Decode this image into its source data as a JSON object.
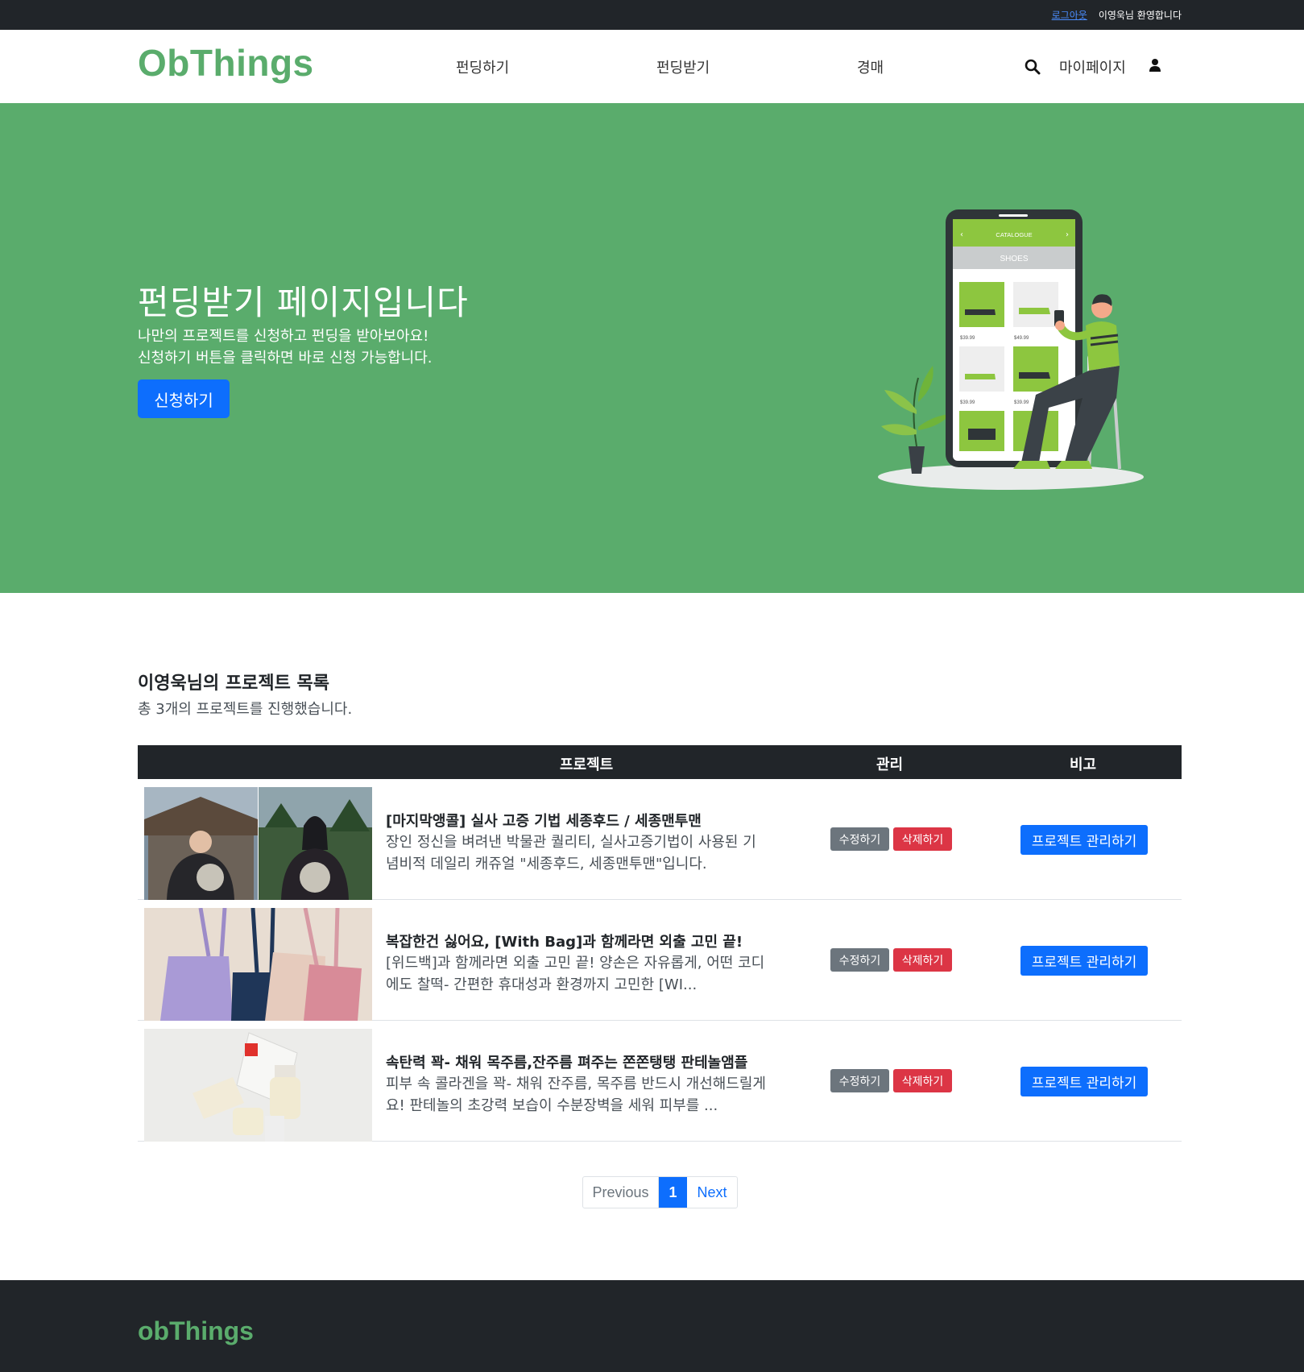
{
  "topbar": {
    "logout": "로그아웃",
    "welcome": "이영욱님 환영합니다"
  },
  "nav": {
    "logo": "ObThings",
    "items": [
      "펀딩하기",
      "펀딩받기",
      "경매"
    ],
    "mypage": "마이페이지",
    "icons": [
      "search-icon",
      "user-icon"
    ]
  },
  "hero": {
    "title": "펀딩받기 페이지입니다",
    "line1": "나만의 프로젝트를 신청하고 펀딩을 받아보아요!",
    "line2": "신청하기 버튼을 클릭하면 바로 신청 가능합니다.",
    "apply_label": "신청하기",
    "phone": {
      "header": "CATALOGUE",
      "category": "SHOES",
      "prices": [
        "$39.99",
        "$49.99",
        "$39.99",
        "$39.99"
      ]
    }
  },
  "list": {
    "title": "이영욱님의 프로젝트 목록",
    "summary": "총 3개의 프로젝트를 진행했습니다.",
    "headers": {
      "project": "프로젝트",
      "manage": "관리",
      "note": "비고"
    },
    "rows": [
      {
        "title": "[마지막앵콜] 실사 고증 기법 세종후드 / 세종맨투맨",
        "desc1": "장인 정신을 벼려낸 박물관 퀄리티, 실사고증기법이 사용된 기",
        "desc2": "념비적 데일리 캐쥬얼 \"세종후드, 세종맨투맨\"입니다.",
        "edit": "수정하기",
        "delete": "삭제하기",
        "manage": "프로젝트 관리하기"
      },
      {
        "title": "복잡한건 싫어요, [With Bag]과 함께라면 외출 고민 끝!",
        "desc1": "[위드백]과 함께라면 외출 고민 끝! 양손은 자유롭게, 어떤 코디",
        "desc2": "에도 찰떡- 간편한 휴대성과 환경까지 고민한 [WI...",
        "edit": "수정하기",
        "delete": "삭제하기",
        "manage": "프로젝트 관리하기"
      },
      {
        "title": "속탄력 꽉- 채워 목주름,잔주름 펴주는 쫀쫀탱탱 판테놀앰플",
        "desc1": "피부 속 콜라겐을 꽉- 채워 잔주름, 목주름 반드시 개선해드릴게",
        "desc2": "요! 판테놀의 초강력 보습이 수분장벽을 세워 피부를 ...",
        "edit": "수정하기",
        "delete": "삭제하기",
        "manage": "프로젝트 관리하기"
      }
    ]
  },
  "pagination": {
    "prev": "Previous",
    "current": "1",
    "next": "Next"
  },
  "footer": {
    "logo": "obThings"
  },
  "colors": {
    "brand": "#5aac6c",
    "primary": "#0d6efd",
    "danger": "#dc3545",
    "secondary": "#6c757d",
    "dark": "#212529"
  }
}
